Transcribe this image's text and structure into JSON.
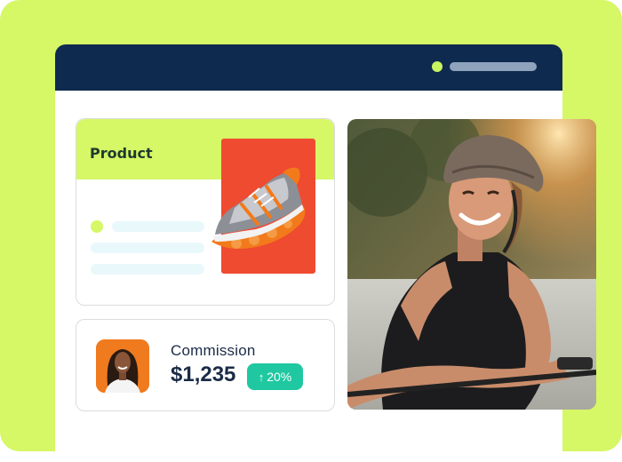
{
  "product_card": {
    "title": "Product"
  },
  "commission_card": {
    "label": "Commission",
    "amount": "$1,235",
    "change": "20%",
    "change_direction": "up"
  },
  "colors": {
    "lime": "#d6f766",
    "navy": "#0f2a4f",
    "shoe_panel": "#ef4b30",
    "badge": "#1fc8a0",
    "avatar_bg": "#f07a1e"
  },
  "icons": {
    "shoe": "sneaker-image",
    "avatar": "person-avatar",
    "badge_arrow": "arrow-up-icon"
  }
}
